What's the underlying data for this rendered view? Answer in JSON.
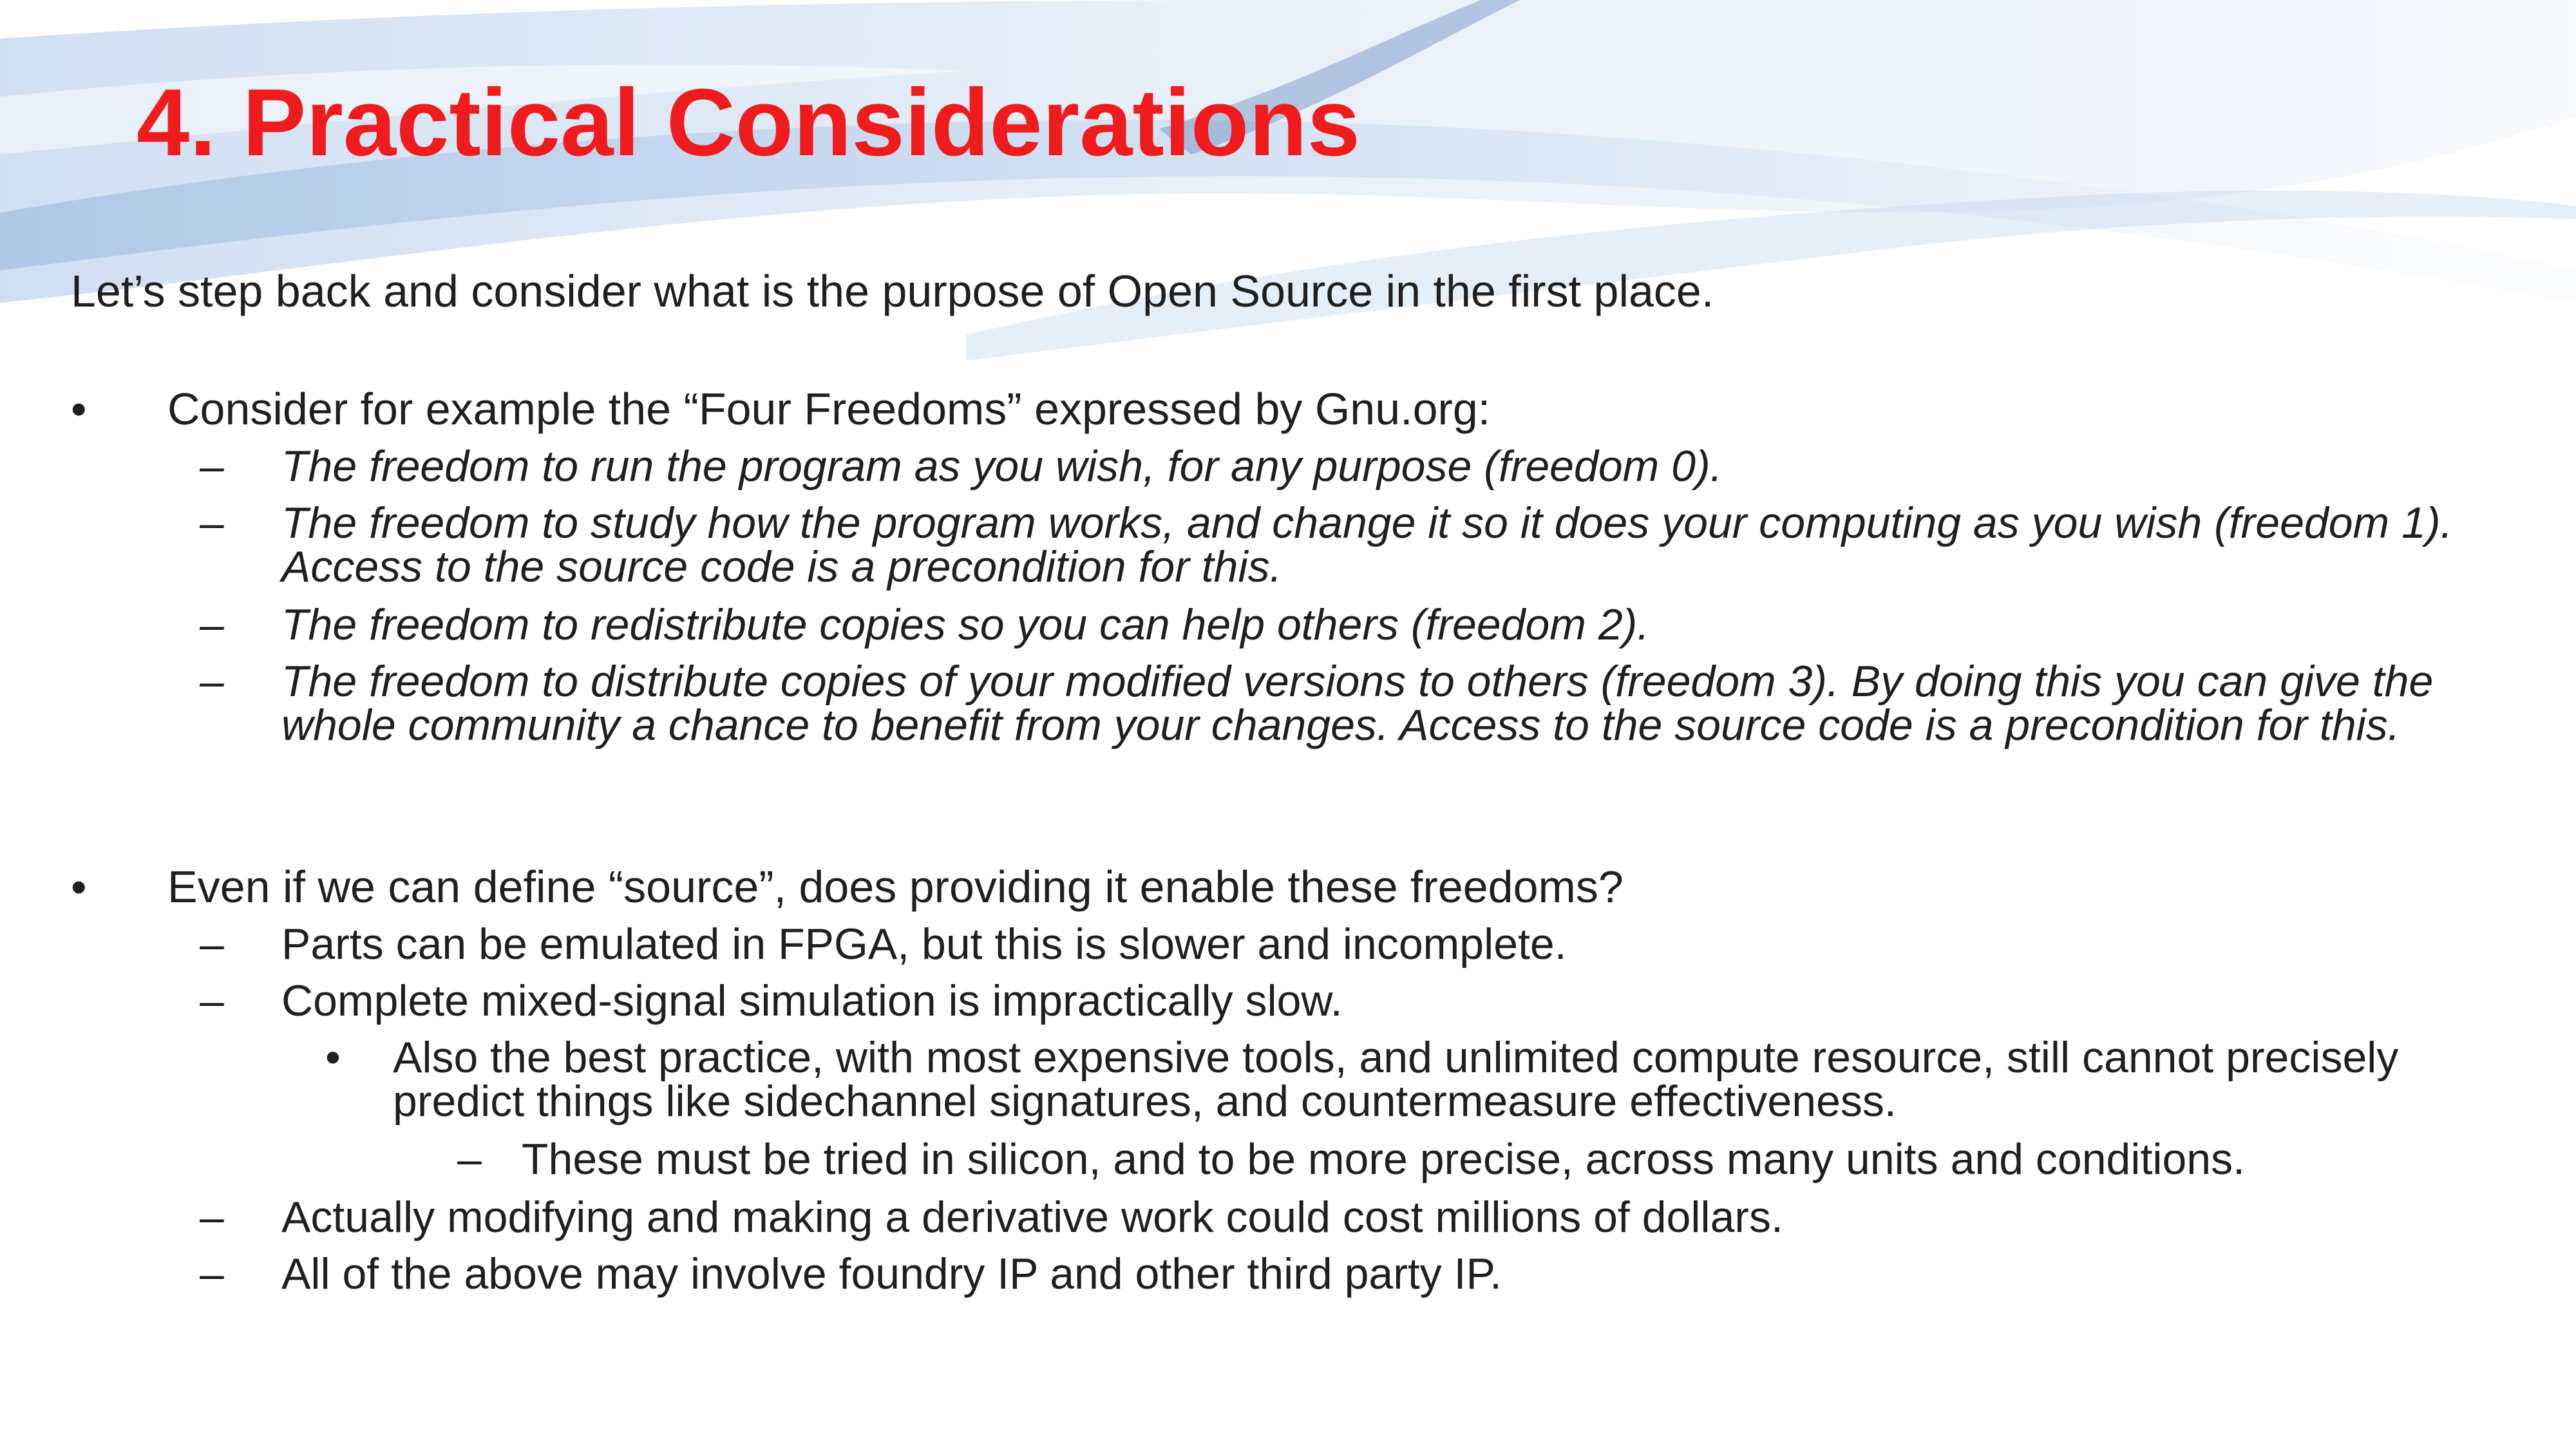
{
  "slide": {
    "title": "4. Practical Considerations",
    "colors": {
      "title": "#ee1c1c",
      "text": "#1f1f1f",
      "swoosh": "#a9c4e6"
    },
    "intro": "Let’s step back and consider what is the purpose of Open Source in the first place.",
    "bullets": [
      {
        "marker": "•",
        "text": "Consider for example the “Four Freedoms” expressed by Gnu.org:",
        "subitems": [
          {
            "marker": "–",
            "text": "The freedom to run the program as you wish, for any purpose (freedom 0)."
          },
          {
            "marker": "–",
            "text": "The freedom to study how the program works, and change it so it does your computing as you wish (freedom 1). Access to the source code is a precondition for this."
          },
          {
            "marker": "–",
            "text": "The freedom to redistribute copies so you can help others (freedom 2)."
          },
          {
            "marker": "–",
            "text": "The freedom to distribute copies of your modified versions to others (freedom 3). By doing this you can give the whole community a chance to benefit from your changes. Access to the source code is a precondition for this."
          }
        ]
      },
      {
        "marker": "•",
        "text": "Even if we can define “source”, does providing it enable these freedoms?",
        "subitems": [
          {
            "marker": "–",
            "text": "Parts can be emulated in FPGA, but this is slower and incomplete."
          },
          {
            "marker": "–",
            "text": "Complete mixed-signal simulation is impractically slow."
          },
          {
            "marker": "•",
            "text": "Also the best practice, with most expensive tools, and unlimited compute resource, still cannot precisely predict things like sidechannel signatures, and countermeasure effectiveness."
          },
          {
            "marker": "–",
            "text": "These must be tried in silicon, and to be more precise, across many units and conditions."
          },
          {
            "marker": "–",
            "text": "Actually modifying and making a derivative work could cost millions of dollars."
          },
          {
            "marker": "–",
            "text": "All of the above may involve foundry IP and other third party IP."
          }
        ]
      }
    ]
  }
}
